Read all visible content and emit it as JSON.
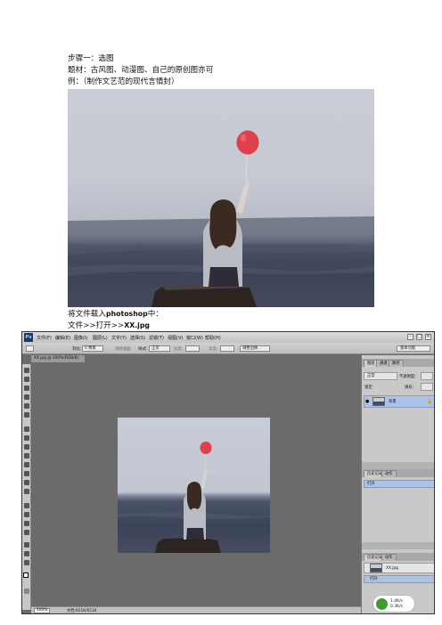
{
  "doc": {
    "line1": "步骤一：选图",
    "line2": "题材：古风图、动漫图、自己的原创图亦可",
    "line3": "例：（制作文艺范的现代言情封）",
    "line4_prefix": "将文件载入",
    "line4_app": "photoshop",
    "line4_suffix": "中：",
    "line5_prefix": "文件>>打开>>",
    "line5_file": "XX.jpg"
  },
  "photoshop": {
    "logo": "Ps",
    "menus": [
      "文件(F)",
      "编辑(E)",
      "图像(I)",
      "图层(L)",
      "文字(Y)",
      "选择(S)",
      "滤镜(T)",
      "视图(V)",
      "窗口(W)",
      "帮助(H)"
    ],
    "options": {
      "feather_label": "羽化:",
      "feather_value": "0 像素",
      "antialias": "消除锯齿",
      "style_label": "样式:",
      "style_value": "正常",
      "width_label": "宽度:",
      "height_label": "高度:",
      "refine_edge": "调整边缘..."
    },
    "workspace": "基本功能",
    "doc_tab": "XX.jpg @ 100%(RGB/8)",
    "zoom": "100%",
    "status": "文档:651K/651K",
    "layers_panel": {
      "tabs": [
        "图层",
        "通道",
        "路径"
      ],
      "blend": "正常",
      "opacity_label": "不透明度:",
      "lock_label": "锁定:",
      "fill_label": "填充:",
      "layer_name": "背景"
    },
    "history_panel": {
      "tabs": [
        "历史记录",
        "动作"
      ],
      "item": "打开"
    },
    "bottom_panel": {
      "tabs": [
        "历史记录",
        "动作"
      ],
      "file": "XX.jpg",
      "item": "打开"
    }
  },
  "badge": {
    "line1": "1.4K/s",
    "line2": "0.3K/s"
  }
}
